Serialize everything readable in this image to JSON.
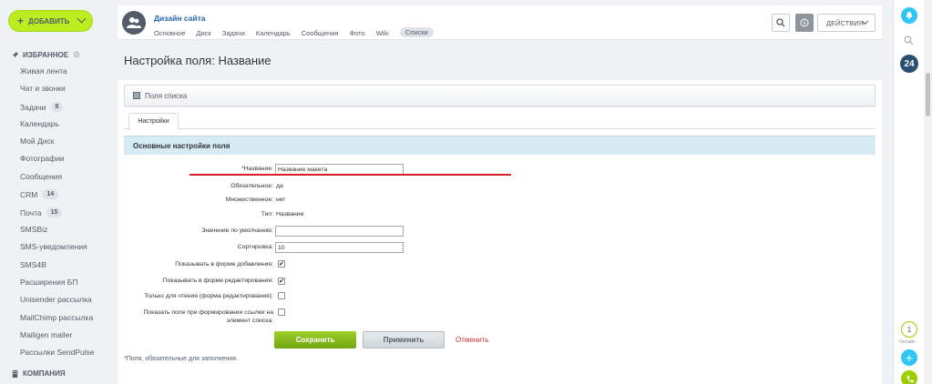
{
  "sidebar": {
    "add_button": "ДОБАВИТЬ",
    "favorites_title": "ИЗБРАННОЕ",
    "items": [
      {
        "label": "Живая лента"
      },
      {
        "label": "Чат и звонки"
      },
      {
        "label": "Задачи",
        "badge": "8"
      },
      {
        "label": "Календарь"
      },
      {
        "label": "Мой Диск"
      },
      {
        "label": "Фотографии"
      },
      {
        "label": "Сообщения"
      },
      {
        "label": "CRM",
        "badge": "14"
      },
      {
        "label": "Почта",
        "badge": "15"
      },
      {
        "label": "SMSBiz"
      },
      {
        "label": "SMS-уведомления"
      },
      {
        "label": "SMS4B"
      },
      {
        "label": "Расширения БП"
      },
      {
        "label": "Unisender рассылка"
      },
      {
        "label": "MailChimp рассылка"
      },
      {
        "label": "Mailigen mailer"
      },
      {
        "label": "Рассылки SendPulse"
      }
    ],
    "company_title": "КОМПАНИЯ"
  },
  "header": {
    "group_title": "Дизайн сайта",
    "tabs": [
      "Основное",
      "Диск",
      "Задачи",
      "Календарь",
      "Сообщения",
      "Фото",
      "Wiki",
      "Списки"
    ],
    "actions_label": "ДЕЙСТВИЯ"
  },
  "page_title": "Настройка поля: Название",
  "list_bar_label": "Поля списка",
  "tab_label": "Настройки",
  "section_title": "Основные настройки поля",
  "form": {
    "name_label": "*Название:",
    "name_value": "Название макета",
    "required_label": "Обязательное:",
    "required_value": "да",
    "multiple_label": "Множественное:",
    "multiple_value": "нет",
    "type_label": "Тип:",
    "type_value": "Название",
    "default_label": "Значение по умолчанию:",
    "default_value": "",
    "sort_label": "Сортировка:",
    "sort_value": "10",
    "show_add_label": "Показывать в форме добавления:",
    "show_add_checked": true,
    "show_edit_label": "Показывать в форме редактирования:",
    "show_edit_checked": true,
    "readonly_label": "Только для чтения (форма редактирования):",
    "readonly_checked": false,
    "show_link_label": "Показать поле при формировании ссылки на элемент списка:",
    "show_link_checked": false
  },
  "buttons": {
    "save": "Сохранить",
    "apply": "Применить",
    "cancel": "Отменить"
  },
  "footnote": "*Поля, обязательные для заполнения.",
  "rightbar": {
    "b24_label": "24",
    "online_count": "1",
    "online_label": "Онлайн"
  },
  "colors": {
    "accent_green": "#bbed21",
    "link_blue": "#2067b0",
    "cancel_red": "#d3322f",
    "section_blue": "#d7ebf5"
  }
}
